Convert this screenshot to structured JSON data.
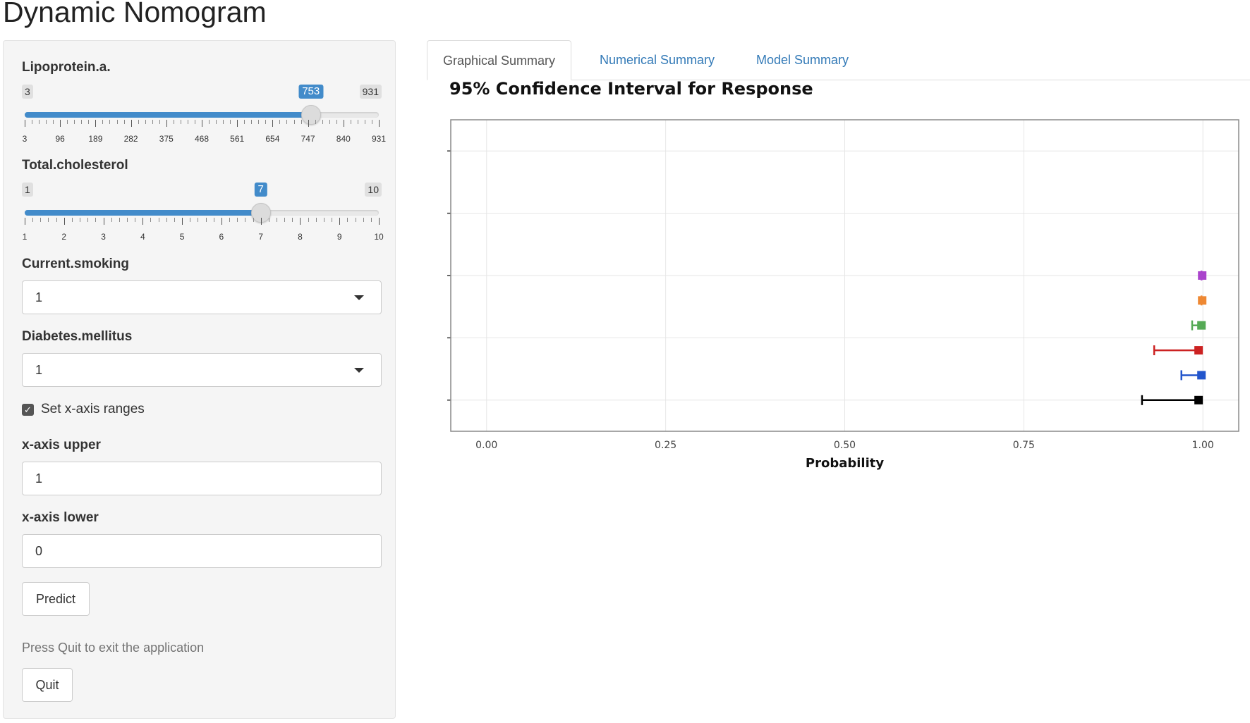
{
  "app": {
    "title": "Dynamic Nomogram"
  },
  "sidebar": {
    "slider1": {
      "label": "Lipoprotein.a.",
      "min": 3,
      "max": 931,
      "value": 753,
      "min_label": "3",
      "max_label": "931",
      "value_label": "753",
      "ticks": [
        "3",
        "96",
        "189",
        "282",
        "375",
        "468",
        "561",
        "654",
        "747",
        "840",
        "931"
      ]
    },
    "slider2": {
      "label": "Total.cholesterol",
      "min": 1,
      "max": 10,
      "value": 7,
      "min_label": "1",
      "max_label": "10",
      "value_label": "7",
      "ticks": [
        "1",
        "2",
        "3",
        "4",
        "5",
        "6",
        "7",
        "8",
        "9",
        "10"
      ]
    },
    "smoking": {
      "label": "Current.smoking",
      "value": "1"
    },
    "diabetes": {
      "label": "Diabetes.mellitus",
      "value": "1"
    },
    "set_range": {
      "label": "Set x-axis ranges",
      "checked": true
    },
    "x_upper": {
      "label": "x-axis upper",
      "value": "1"
    },
    "x_lower": {
      "label": "x-axis lower",
      "value": "0"
    },
    "predict_label": "Predict",
    "quit_help": "Press Quit to exit the application",
    "quit_label": "Quit"
  },
  "tabs": [
    {
      "label": "Graphical Summary",
      "active": true
    },
    {
      "label": "Numerical Summary",
      "active": false
    },
    {
      "label": "Model Summary",
      "active": false
    }
  ],
  "chart_data": {
    "type": "scatter",
    "title": "95% Confidence Interval for Response",
    "xlabel": "Probability",
    "ylabel": "",
    "xlim": [
      -0.05,
      1.05
    ],
    "x_ticks": [
      "0.00",
      "0.25",
      "0.50",
      "0.75",
      "1.00"
    ],
    "x_tick_values": [
      0,
      0.25,
      0.5,
      0.75,
      1.0
    ],
    "y_tick_count": 5,
    "grid": true,
    "series": [
      {
        "color": "#000000",
        "estimate": 0.994,
        "lower": 0.915,
        "upper": 0.998,
        "row": 1
      },
      {
        "color": "#2255cc",
        "estimate": 0.998,
        "lower": 0.97,
        "upper": 1.0,
        "row": 1.4
      },
      {
        "color": "#cc2222",
        "estimate": 0.994,
        "lower": 0.932,
        "upper": 0.998,
        "row": 1.8
      },
      {
        "color": "#55aa55",
        "estimate": 0.998,
        "lower": 0.985,
        "upper": 1.0,
        "row": 2.2
      },
      {
        "color": "#ee8833",
        "estimate": 0.999,
        "lower": 0.998,
        "upper": 1.0,
        "row": 2.6
      },
      {
        "color": "#aa44cc",
        "estimate": 0.999,
        "lower": 0.998,
        "upper": 1.0,
        "row": 3.0
      }
    ]
  }
}
